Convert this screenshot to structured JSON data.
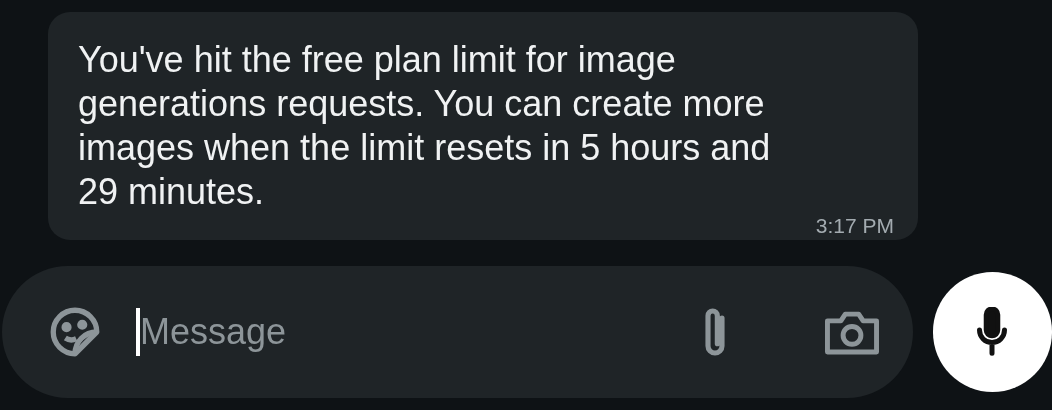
{
  "message": {
    "text": "You've hit the free plan limit for image generations requests. You can create more images when the limit resets in 5 hours and 29 minutes.",
    "time": "3:17 PM"
  },
  "composer": {
    "placeholder": "Message"
  }
}
